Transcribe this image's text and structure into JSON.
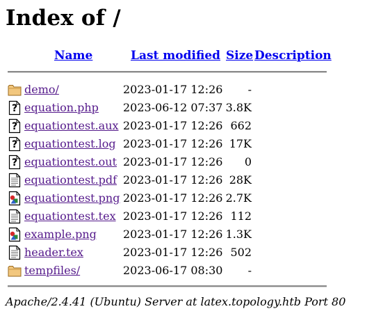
{
  "page": {
    "title": "Index of /"
  },
  "columns": {
    "name": "Name",
    "last_modified": "Last modified",
    "size": "Size",
    "description": "Description"
  },
  "files": [
    {
      "icon": "folder-icon",
      "name": "demo/",
      "modified": "2023-01-17 12:26",
      "size": "-"
    },
    {
      "icon": "unknown-file-icon",
      "name": "equation.php",
      "modified": "2023-06-12 07:37",
      "size": "3.8K"
    },
    {
      "icon": "unknown-file-icon",
      "name": "equationtest.aux",
      "modified": "2023-01-17 12:26",
      "size": "662"
    },
    {
      "icon": "unknown-file-icon",
      "name": "equationtest.log",
      "modified": "2023-01-17 12:26",
      "size": "17K"
    },
    {
      "icon": "unknown-file-icon",
      "name": "equationtest.out",
      "modified": "2023-01-17 12:26",
      "size": "0"
    },
    {
      "icon": "text-file-icon",
      "name": "equationtest.pdf",
      "modified": "2023-01-17 12:26",
      "size": "28K"
    },
    {
      "icon": "image-file-icon",
      "name": "equationtest.png",
      "modified": "2023-01-17 12:26",
      "size": "2.7K"
    },
    {
      "icon": "text-file-icon",
      "name": "equationtest.tex",
      "modified": "2023-01-17 12:26",
      "size": "112"
    },
    {
      "icon": "image-file-icon",
      "name": "example.png",
      "modified": "2023-01-17 12:26",
      "size": "1.3K"
    },
    {
      "icon": "text-file-icon",
      "name": "header.tex",
      "modified": "2023-01-17 12:26",
      "size": "502"
    },
    {
      "icon": "folder-icon",
      "name": "tempfiles/",
      "modified": "2023-06-17 08:30",
      "size": "-"
    }
  ],
  "footer": {
    "address": "Apache/2.4.41 (Ubuntu) Server at latex.topology.htb Port 80"
  },
  "colors": {
    "link": "#0000EE",
    "visited_link": "#551A8B",
    "rule": "#8a8a8a"
  }
}
